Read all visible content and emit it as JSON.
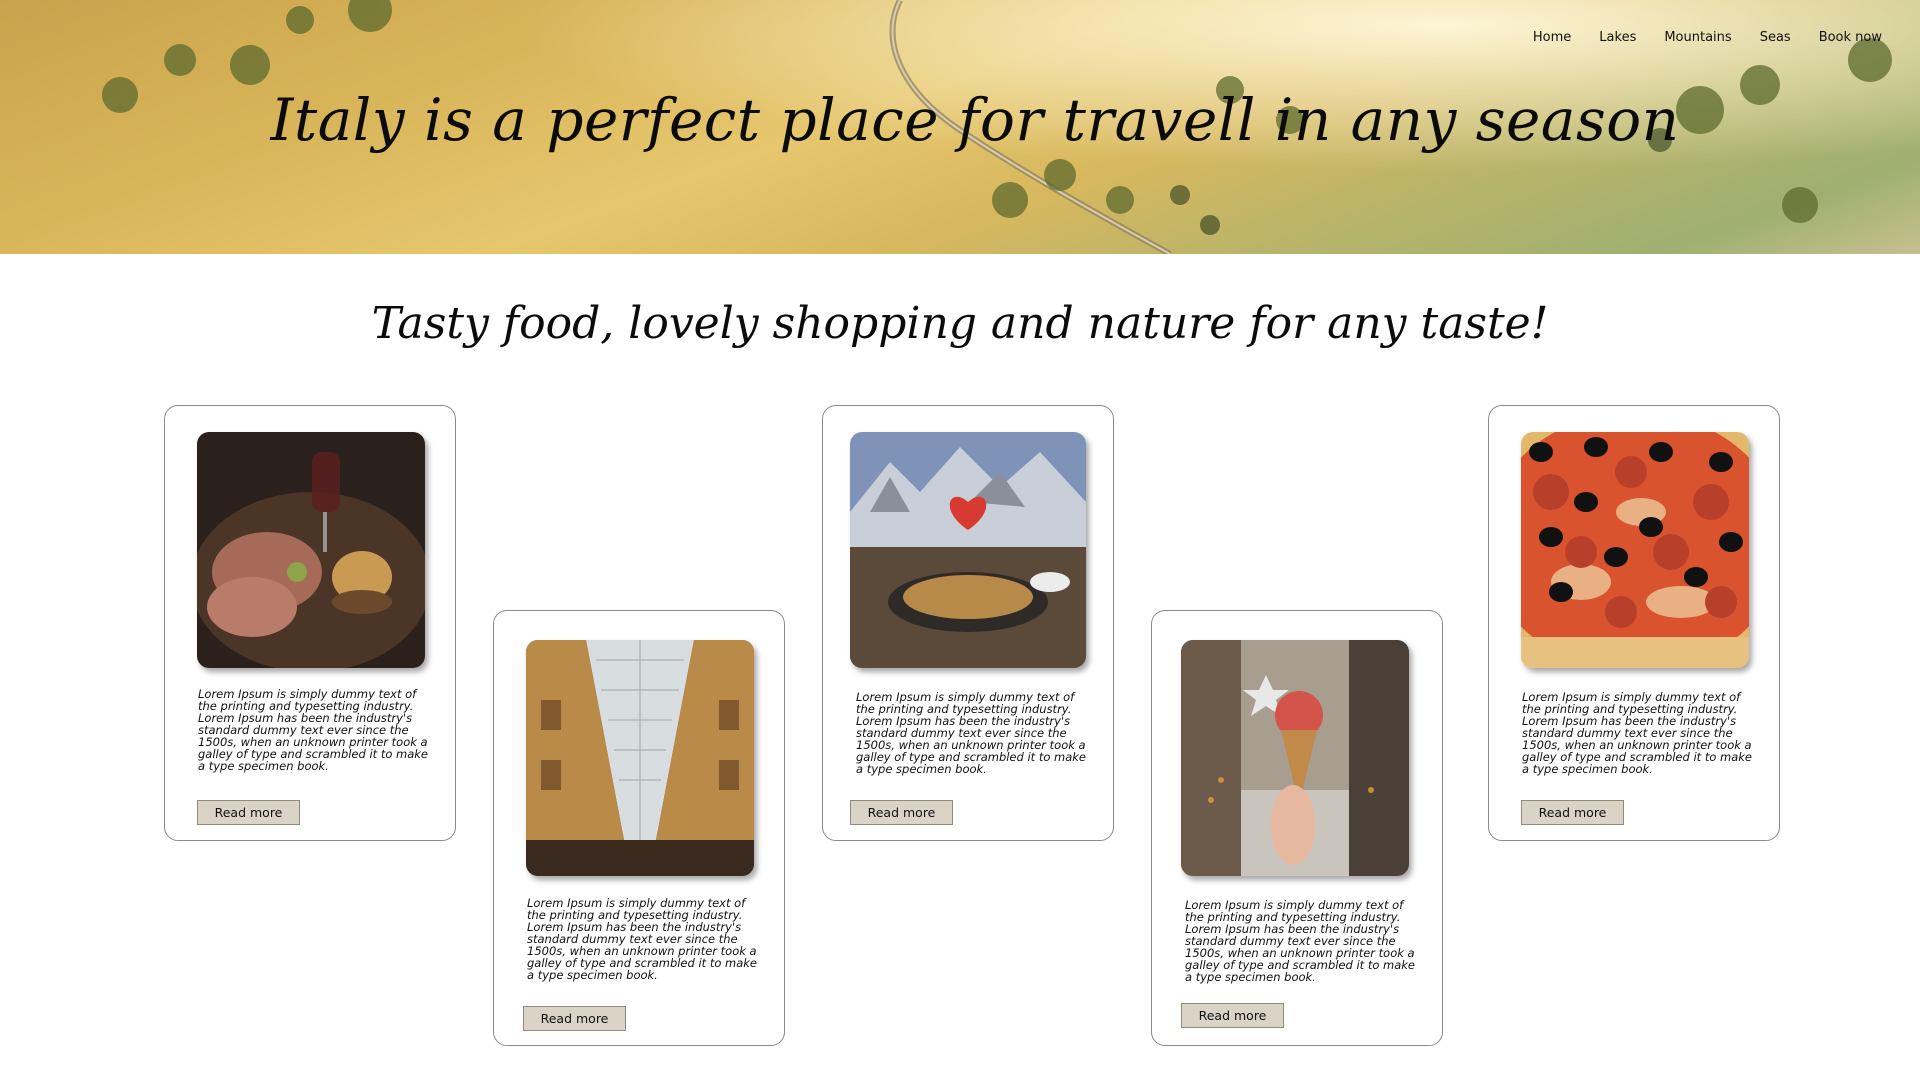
{
  "hero": {
    "title": "Italy is a perfect place for travell in any season"
  },
  "nav": {
    "items": [
      {
        "label": "Home"
      },
      {
        "label": "Lakes"
      },
      {
        "label": "Mountains"
      },
      {
        "label": "Seas"
      },
      {
        "label": "Book now"
      }
    ]
  },
  "section": {
    "subtitle": "Tasty food, lovely shopping and nature for any taste!"
  },
  "cards": [
    {
      "image": "charcuterie-and-wine-photo",
      "text": "Lorem Ipsum is simply dummy text of the printing and typesetting industry. Lorem Ipsum has been the industry's standard dummy text ever since the 1500s, when an unknown printer took a galley of type and scrambled it to make a type specimen book.",
      "button": "Read more"
    },
    {
      "image": "shopping-gallery-photo",
      "text": "Lorem Ipsum is simply dummy text of the printing and typesetting industry. Lorem Ipsum has been the industry's standard dummy text ever since the 1500s, when an unknown printer took a galley of type and scrambled it to make a type specimen book.",
      "button": "Read more"
    },
    {
      "image": "mountain-dish-photo",
      "text": "Lorem Ipsum is simply dummy text of the printing and typesetting industry. Lorem Ipsum has been the industry's standard dummy text ever since the 1500s, when an unknown printer took a galley of type and scrambled it to make a type specimen book.",
      "button": "Read more"
    },
    {
      "image": "gelato-street-photo",
      "text": "Lorem Ipsum is simply dummy text of the printing and typesetting industry. Lorem Ipsum has been the industry's standard dummy text ever since the 1500s, when an unknown printer took a galley of type and scrambled it to make a type specimen book.",
      "button": "Read more"
    },
    {
      "image": "pizza-photo",
      "text": "Lorem Ipsum is simply dummy text of the printing and typesetting industry. Lorem Ipsum has been the industry's standard dummy text ever since the 1500s, when an unknown printer took a galley of type and scrambled it to make a type specimen book.",
      "button": "Read more"
    }
  ],
  "colors": {
    "button_bg": "#d9d4c6",
    "hero_gold": "#d9b55a",
    "card_border": "#8a8a8a"
  }
}
